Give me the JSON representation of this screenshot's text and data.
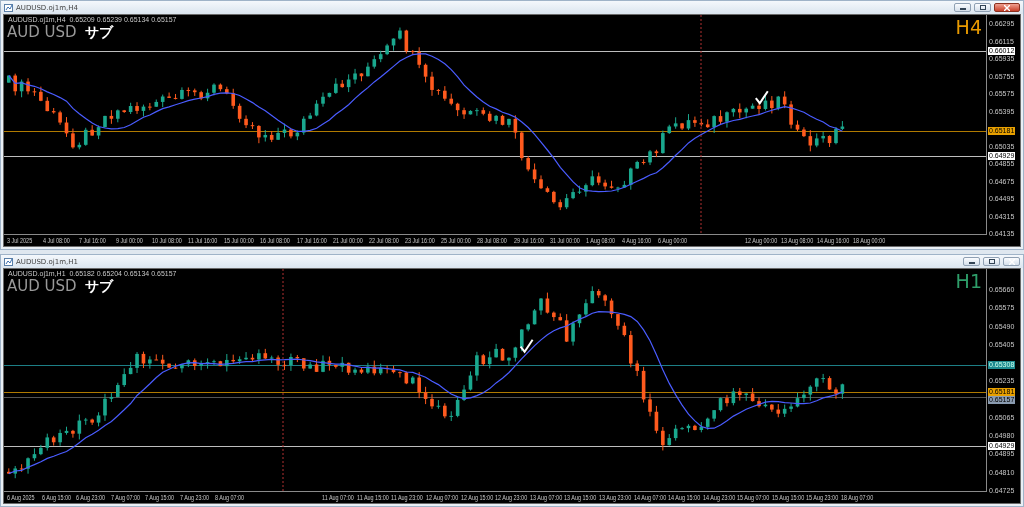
{
  "charts": [
    {
      "window_title": "AUDUSD.oj1m,H4",
      "active": true,
      "header": "AUDUSD.oj1m,H4  0.65209 0.65239 0.65134 0.65157",
      "symbol": "AUD USD",
      "subtitle": "サブ",
      "timeframe": "H4",
      "color": "#e89a00",
      "price_ticks": [
        "0.66295",
        "0.66115",
        "0.65935",
        "0.65755",
        "0.65575",
        "0.65395",
        "0.65035",
        "0.64855",
        "0.64675",
        "0.64495",
        "0.64315",
        "0.64135"
      ],
      "price_lines": [
        {
          "price": "0.66012",
          "kind": "level"
        },
        {
          "price": "0.65181",
          "kind": "bid"
        },
        {
          "price": "0.64929",
          "kind": "level"
        }
      ],
      "time_ticks": [
        "3 Jul 2025",
        "4 Jul 08:00",
        "7 Jul 16:00",
        "9 Jul 00:00",
        "10 Jul 08:00",
        "11 Jul 16:00",
        "15 Jul 00:00",
        "16 Jul 08:00",
        "17 Jul 16:00",
        "21 Jul 00:00",
        "22 Jul 08:00",
        "23 Jul 16:00",
        "25 Jul 00:00",
        "28 Jul 08:00",
        "29 Jul 16:00",
        "31 Jul 00:00",
        "1 Aug 08:00",
        "4 Aug 16:00",
        "6 Aug 00:00",
        "12 Aug 00:00",
        "13 Aug 08:00",
        "14 Aug 16:00",
        "18 Aug 00:00"
      ]
    },
    {
      "window_title": "AUDUSD.oj1m,H1",
      "active": false,
      "header": "AUDUSD.oj1m,H1  0.65182 0.65204 0.65134 0.65157",
      "symbol": "AUD USD",
      "subtitle": "サブ",
      "timeframe": "H1",
      "color": "#2e9e6a",
      "price_ticks": [
        "0.65660",
        "0.65575",
        "0.65490",
        "0.65405",
        "0.65235",
        "0.65065",
        "0.64980",
        "0.64895",
        "0.64810",
        "0.64725"
      ],
      "price_lines": [
        {
          "price": "0.65308",
          "kind": "alert"
        },
        {
          "price": "0.65181",
          "kind": "bid"
        },
        {
          "price": "0.65157",
          "kind": "ask"
        },
        {
          "price": "0.64929",
          "kind": "level"
        }
      ],
      "time_ticks": [
        "6 Aug 2025",
        "6 Aug 15:00",
        "6 Aug 23:00",
        "7 Aug 07:00",
        "7 Aug 15:00",
        "7 Aug 23:00",
        "8 Aug 07:00",
        "11 Aug 07:00",
        "11 Aug 15:00",
        "11 Aug 23:00",
        "12 Aug 07:00",
        "12 Aug 15:00",
        "12 Aug 23:00",
        "13 Aug 07:00",
        "13 Aug 15:00",
        "13 Aug 23:00",
        "14 Aug 07:00",
        "14 Aug 15:00",
        "14 Aug 23:00",
        "15 Aug 07:00",
        "15 Aug 15:00",
        "15 Aug 23:00",
        "18 Aug 07:00"
      ]
    }
  ]
}
